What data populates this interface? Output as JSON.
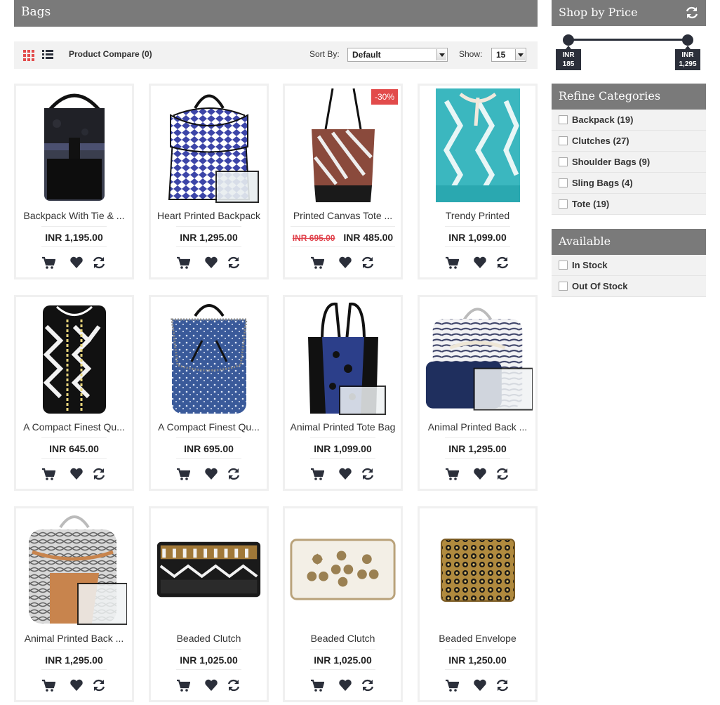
{
  "page": {
    "title": "Bags"
  },
  "toolbar": {
    "compare_label": "Product Compare (0)",
    "sort_label": "Sort By:",
    "sort_value": "Default",
    "show_label": "Show:",
    "show_value": "15"
  },
  "products": [
    {
      "name": "Backpack With Tie & ...",
      "price": "INR 1,195.00"
    },
    {
      "name": "Heart Printed Backpack",
      "price": "INR 1,295.00"
    },
    {
      "name": "Printed Canvas Tote ...",
      "price": "INR 485.00",
      "old_price": "INR 695.00",
      "badge": "-30%"
    },
    {
      "name": "Trendy Printed",
      "price": "INR 1,099.00"
    },
    {
      "name": "A Compact Finest Qu...",
      "price": "INR 645.00"
    },
    {
      "name": "A Compact Finest Qu...",
      "price": "INR 695.00"
    },
    {
      "name": "Animal Printed Tote Bag",
      "price": "INR 1,099.00"
    },
    {
      "name": "Animal Printed Back ...",
      "price": "INR 1,295.00"
    },
    {
      "name": "Animal Printed Back ...",
      "price": "INR 1,295.00"
    },
    {
      "name": "Beaded Clutch",
      "price": "INR 1,025.00"
    },
    {
      "name": "Beaded Clutch",
      "price": "INR 1,025.00"
    },
    {
      "name": "Beaded Envelope",
      "price": "INR 1,250.00"
    }
  ],
  "sidebar": {
    "price": {
      "title": "Shop by Price",
      "min_currency": "INR",
      "min_value": "185",
      "max_currency": "INR",
      "max_value": "1,295"
    },
    "categories": {
      "title": "Refine Categories",
      "items": [
        {
          "label": "Backpack (19)"
        },
        {
          "label": "Clutches (27)"
        },
        {
          "label": "Shoulder Bags (9)"
        },
        {
          "label": "Sling Bags (4)"
        },
        {
          "label": "Tote (19)"
        }
      ]
    },
    "available": {
      "title": "Available",
      "items": [
        {
          "label": "In Stock"
        },
        {
          "label": "Out Of Stock"
        }
      ]
    }
  },
  "colors": {
    "accent": "#e24b4b",
    "header": "#7a7a7a",
    "dark": "#2b2f3a"
  }
}
